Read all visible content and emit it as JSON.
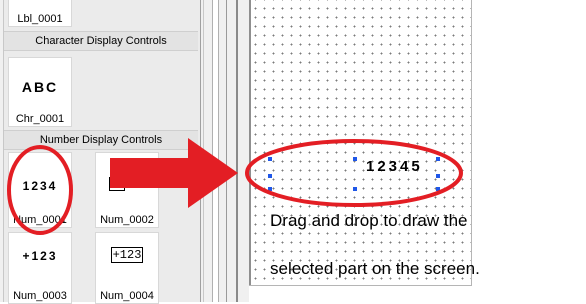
{
  "palette": {
    "top_item": {
      "caption": "Lbl_0001"
    },
    "character_section": {
      "header": "Character Display Controls",
      "item": {
        "glyph": "ABC",
        "caption": "Chr_0001"
      }
    },
    "number_section": {
      "header": "Number Display Controls",
      "items": [
        {
          "glyph": "1234",
          "caption": "Num_0001"
        },
        {
          "glyph": "",
          "caption": "Num_0002"
        },
        {
          "glyph": "+123",
          "caption": "Num_0003"
        },
        {
          "glyph": "+123",
          "caption": "Num_0004"
        }
      ]
    }
  },
  "canvas": {
    "placed_control_value": "12345",
    "instruction_line1": "Drag and drop to draw the",
    "instruction_line2": "selected part on the screen."
  },
  "colors": {
    "annotation": "#e31e24",
    "selection_handle": "#1f57e8",
    "grid_dot": "#7a7a7a"
  },
  "icons": [
    "arrow-right-icon",
    "selection-handle-icon"
  ]
}
